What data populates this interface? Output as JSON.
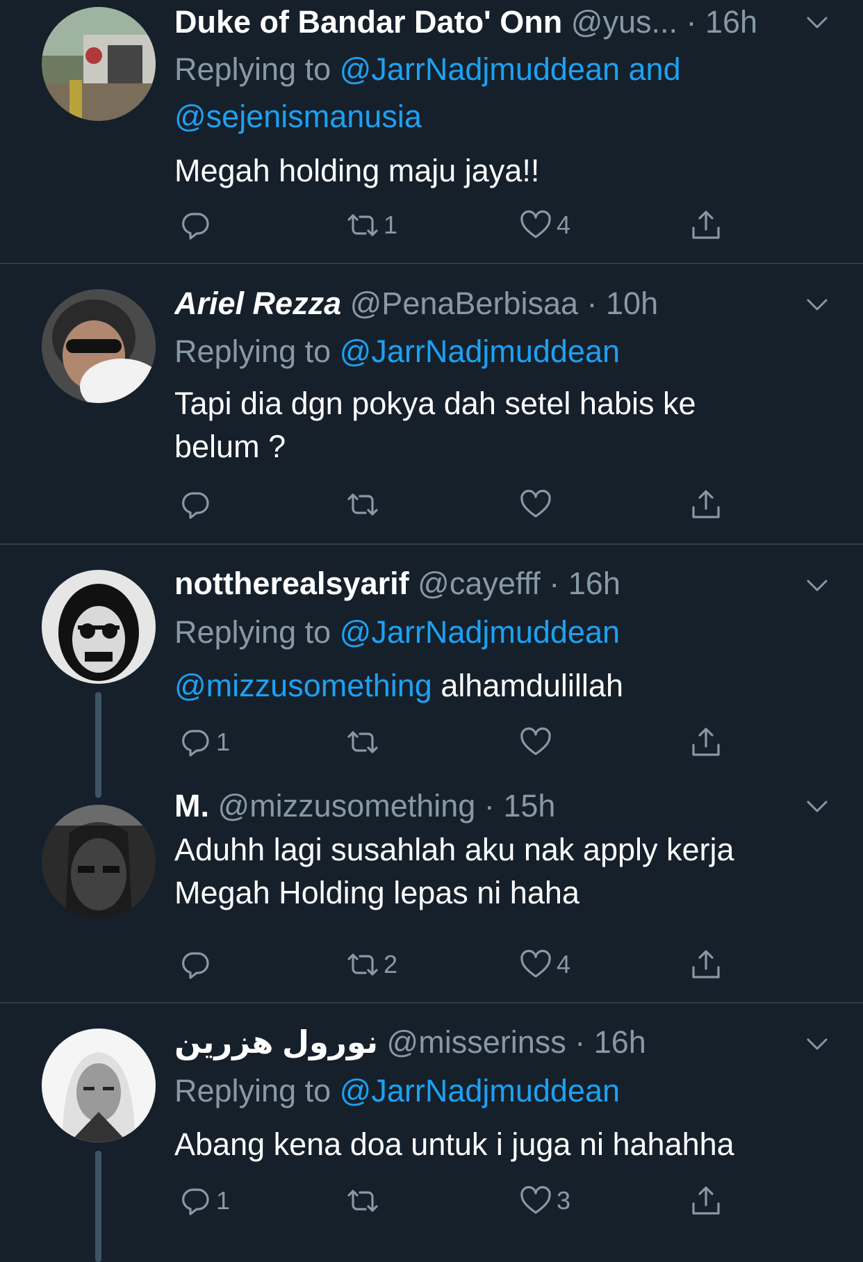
{
  "tweets": [
    {
      "name": "Duke of Bandar Dato' Onn",
      "handle": "@yus...",
      "time": "· 16h",
      "replying_prefix": "Replying to ",
      "replying_line1": "@JarrNadjmuddean and",
      "replying_line2": "@sejenismanusia",
      "text": "Megah holding maju jaya!!",
      "reply_count": "",
      "retweet_count": "1",
      "like_count": "4"
    },
    {
      "name": "Ariel Rezza",
      "handle": "@PenaBerbisaa",
      "time": "· 10h",
      "replying_prefix": "Replying to ",
      "replying_line1": "@JarrNadjmuddean",
      "text_line1": "Tapi dia dgn pokya dah setel habis ke",
      "text_line2": "belum ?",
      "reply_count": "",
      "retweet_count": "",
      "like_count": ""
    },
    {
      "name": "notthe​realsyarif",
      "handle": "@cayefff",
      "time": "· 16h",
      "replying_prefix": "Replying to ",
      "replying_line1": "@JarrNadjmuddean",
      "text_mention": "@mizzusomething",
      "text": " alhamdulillah",
      "reply_count": "1",
      "retweet_count": "",
      "like_count": ""
    },
    {
      "name": "M.",
      "handle": "@mizzusomething",
      "time": "· 15h",
      "text_line1": "Aduhh lagi susahlah aku nak apply kerja",
      "text_line2": "Megah Holding lepas ni haha",
      "reply_count": "",
      "retweet_count": "2",
      "like_count": "4"
    },
    {
      "name": "نورول هزرين",
      "handle": "@misserinss",
      "time": "· 16h",
      "replying_prefix": "Replying to ",
      "replying_line1": "@JarrNadjmuddean",
      "text": "Abang kena doa untuk i juga ni hahahha",
      "reply_count": "1",
      "retweet_count": "",
      "like_count": "3"
    }
  ],
  "colors": {
    "background": "#15202b",
    "secondary_text": "#8899a6",
    "link": "#1da1f2",
    "divider": "#2f3b47",
    "thread_line": "#3d5466"
  }
}
